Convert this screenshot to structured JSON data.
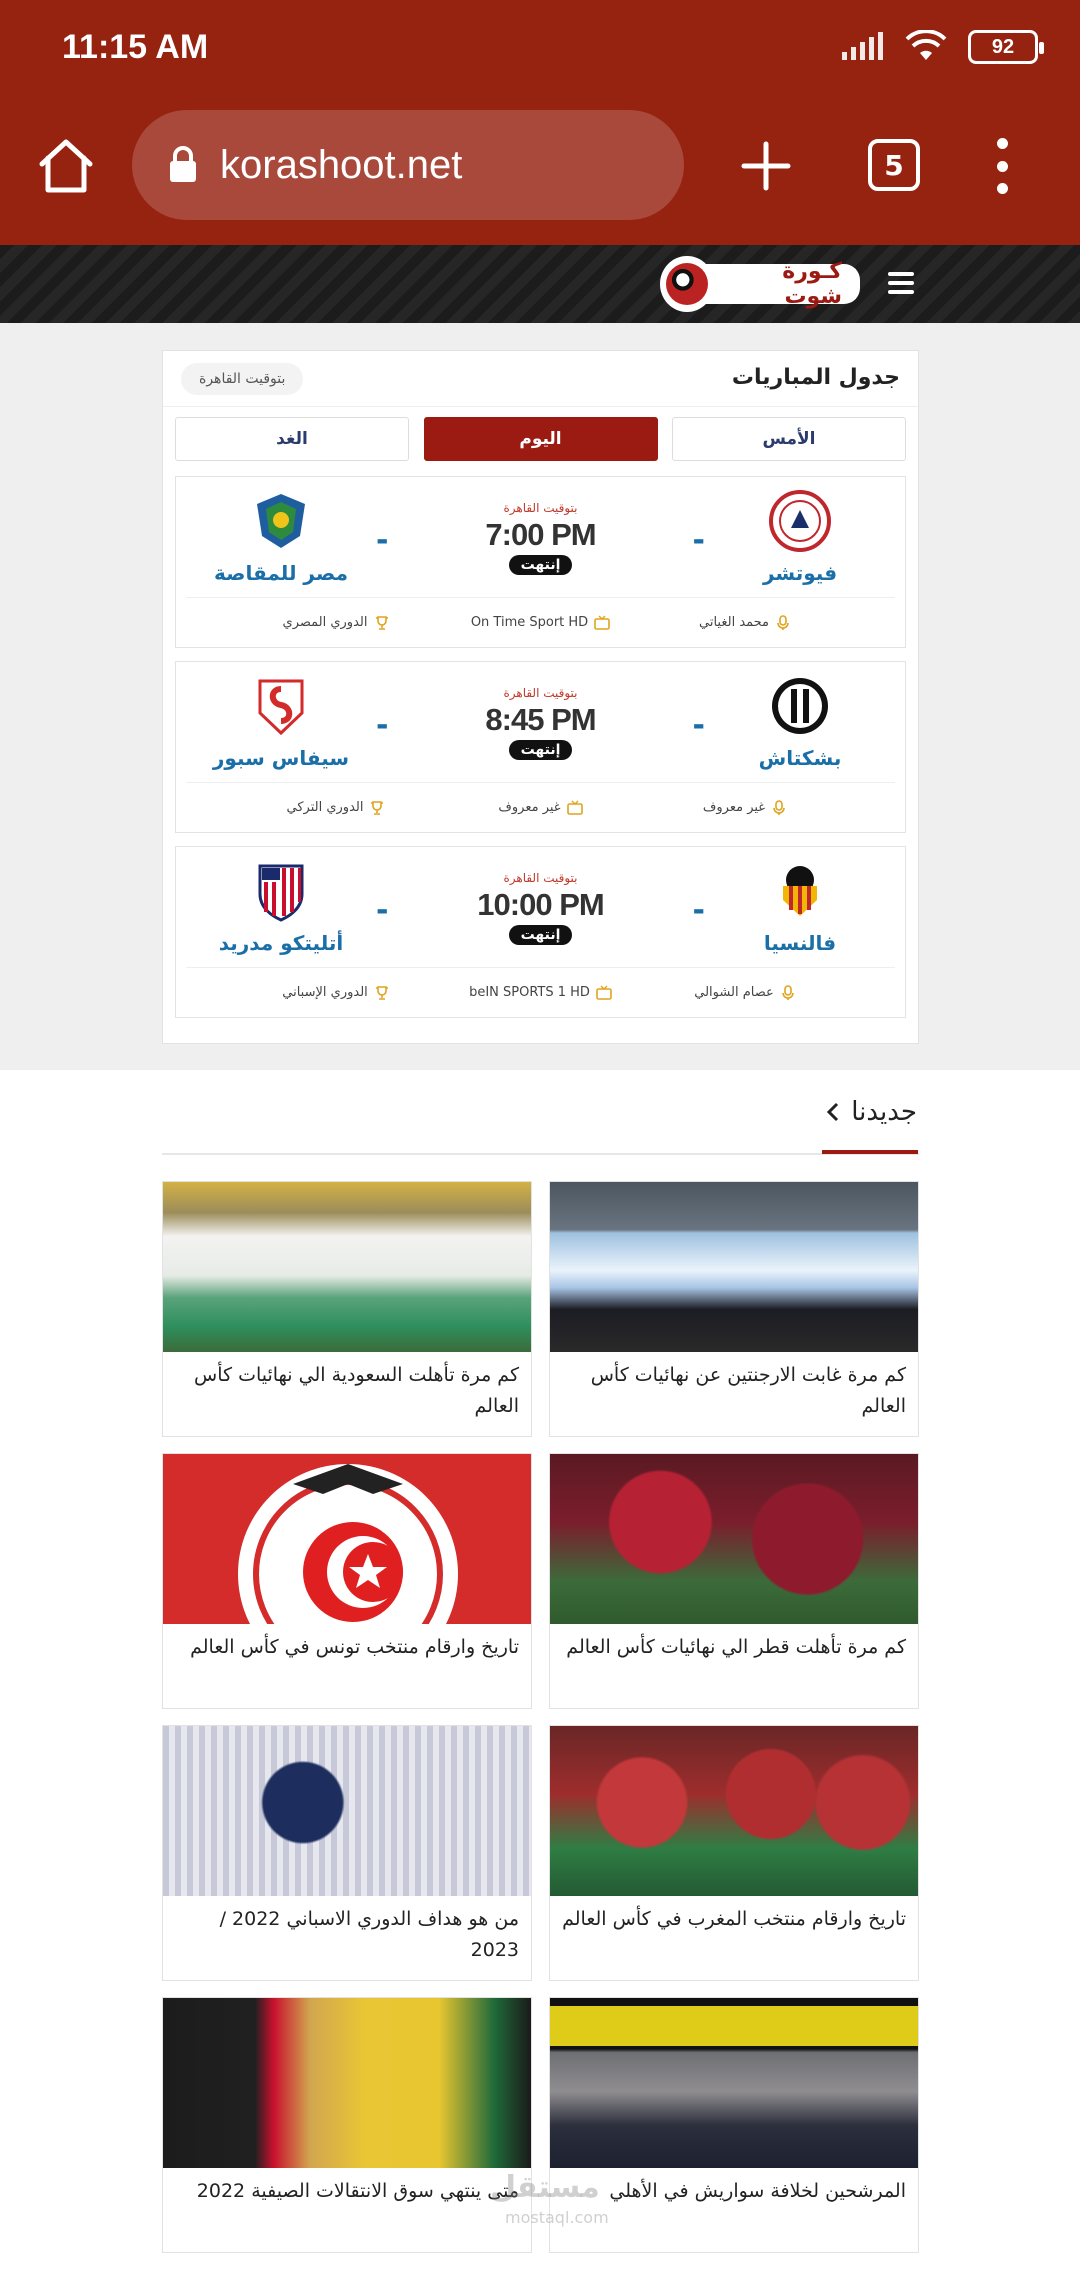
{
  "status_bar": {
    "time": "11:15 AM",
    "battery": "92"
  },
  "browser": {
    "url": "korashoot.net",
    "tab_count": "5"
  },
  "site": {
    "logo_text": "كـورة شوت"
  },
  "matches": {
    "title": "جدول المباريات",
    "timezone_pill": "بتوقيت القاهرة",
    "tabs": [
      {
        "label": "الأمس",
        "active": false
      },
      {
        "label": "اليوم",
        "active": true
      },
      {
        "label": "الغد",
        "active": false
      }
    ],
    "items": [
      {
        "home_team": "فيوتشر",
        "away_team": "مصر للمقاصة",
        "home_score": "-",
        "away_score": "-",
        "timezone": "بتوقيت القاهرة",
        "time": "7:00 PM",
        "status": "إنتهت",
        "commentator": "محمد الغياتي",
        "channel": "On Time Sport HD",
        "league": "الدوري المصري"
      },
      {
        "home_team": "بشكتاش",
        "away_team": "سيفاس سبور",
        "home_score": "-",
        "away_score": "-",
        "timezone": "بتوقيت القاهرة",
        "time": "8:45 PM",
        "status": "إنتهت",
        "commentator": "غير معروف",
        "channel": "غير معروف",
        "league": "الدوري التركي"
      },
      {
        "home_team": "فالنسيا",
        "away_team": "أتليتكو مدريد",
        "home_score": "-",
        "away_score": "-",
        "timezone": "بتوقيت القاهرة",
        "time": "10:00 PM",
        "status": "إنتهت",
        "commentator": "عصام الشوالي",
        "channel": "beIN SPORTS 1 HD",
        "league": "الدوري الإسباني"
      }
    ]
  },
  "news": {
    "title": "جديدنا",
    "articles": [
      {
        "title": "كم مرة غابت الارجنتين عن نهائيات كأس العالم"
      },
      {
        "title": "كم مرة تأهلت السعودية الي نهائيات كأس العالم"
      },
      {
        "title": "كم مرة تأهلت قطر الي نهائيات كأس العالم"
      },
      {
        "title": "تاريخ وارقام منتخب تونس في كأس العالم"
      },
      {
        "title": "تاريخ وارقام منتخب المغرب في كأس العالم"
      },
      {
        "title": "من هو هداف الدوري الاسباني 2022 / 2023"
      },
      {
        "title": "المرشحين لخلافة سواريش في الأهلي"
      },
      {
        "title": "متى ينتهي سوق الانتقالات الصيفية 2022"
      }
    ]
  },
  "watermark": {
    "text": "مستقل",
    "sub": "mostaql.com"
  },
  "colors": {
    "brand": "#962210",
    "accent": "#9b1b13",
    "team_link": "#1b6fa8"
  }
}
